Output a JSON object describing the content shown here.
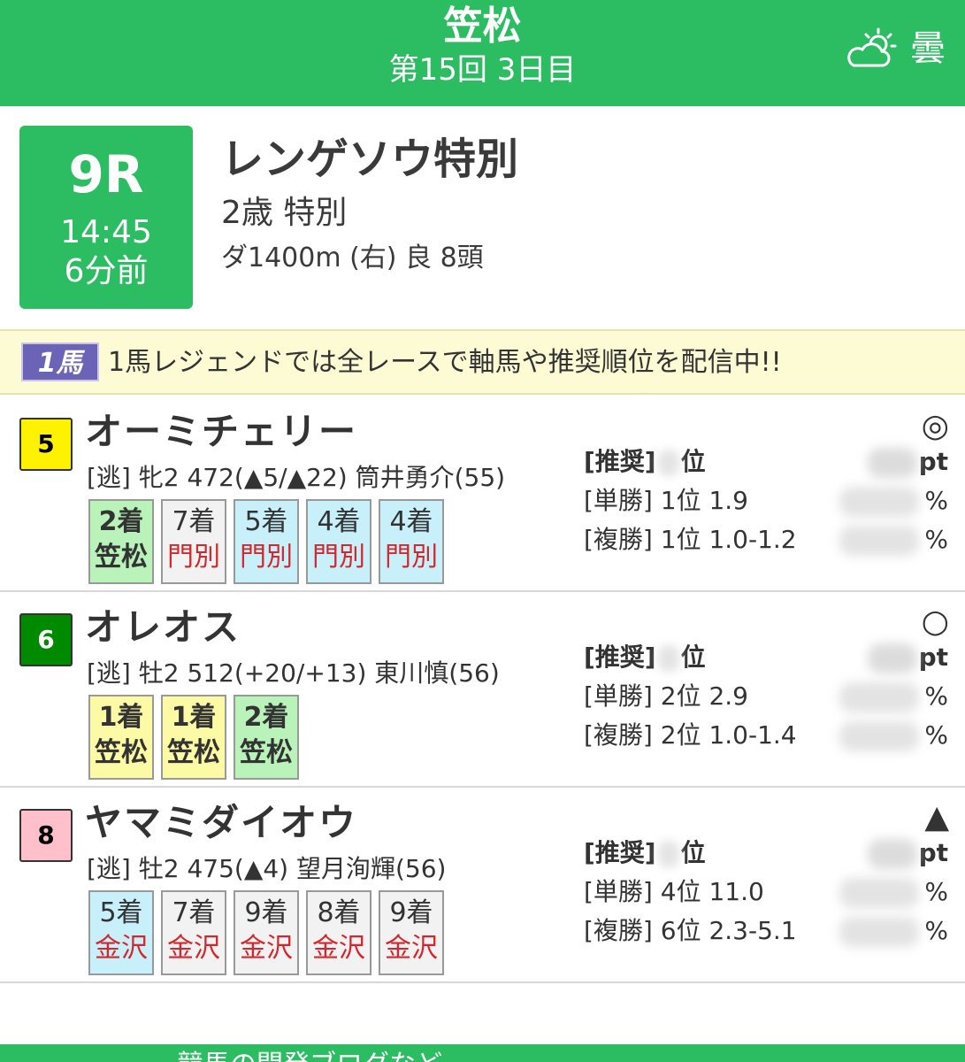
{
  "header": {
    "title": "笠松",
    "subtitle": "第15回 3日目",
    "weather_icon": "cloudy-sun-icon",
    "weather_label": "曇"
  },
  "race": {
    "number": "9R",
    "time": "14:45",
    "countdown": "6分前",
    "name": "レンゲソウ特別",
    "class": "2歳 特別",
    "course": "ダ1400m (右) 良 8頭"
  },
  "banner": {
    "logo": "1馬",
    "text": "1馬レジェンドでは全レースで軸馬や推奨順位を配信中!!"
  },
  "entries": [
    {
      "number": "5",
      "badge_color": "#fff200",
      "badge_text_color": "#000000",
      "name": "オーミチェリー",
      "detail": "[逃] 牝2 472(▲5/▲22) 筒井勇介(55)",
      "mark": "◎",
      "results": [
        {
          "pos": "2着",
          "venue": "笠松",
          "bg": "green",
          "venue_color": "dark",
          "bold": true
        },
        {
          "pos": "7着",
          "venue": "門別",
          "bg": "gray",
          "venue_color": "red",
          "bold": false
        },
        {
          "pos": "5着",
          "venue": "門別",
          "bg": "blue",
          "venue_color": "red",
          "bold": false
        },
        {
          "pos": "4着",
          "venue": "門別",
          "bg": "blue",
          "venue_color": "red",
          "bold": false
        },
        {
          "pos": "4着",
          "venue": "門別",
          "bg": "blue",
          "venue_color": "red",
          "bold": false
        }
      ],
      "recommend_label": "[推奨]",
      "recommend_unit": "位",
      "points_unit": "pt",
      "win": "[単勝] 1位 1.9",
      "place": "[複勝] 1位 1.0-1.2",
      "percent": "%"
    },
    {
      "number": "6",
      "badge_color": "#008a00",
      "badge_text_color": "#ffffff",
      "name": "オレオス",
      "detail": "[逃] 牡2 512(+20/+13) 東川慎(56)",
      "mark": "○",
      "results": [
        {
          "pos": "1着",
          "venue": "笠松",
          "bg": "yellow",
          "venue_color": "dark",
          "bold": true
        },
        {
          "pos": "1着",
          "venue": "笠松",
          "bg": "yellow",
          "venue_color": "dark",
          "bold": true
        },
        {
          "pos": "2着",
          "venue": "笠松",
          "bg": "green",
          "venue_color": "dark",
          "bold": true
        }
      ],
      "recommend_label": "[推奨]",
      "recommend_unit": "位",
      "points_unit": "pt",
      "win": "[単勝] 2位 2.9",
      "place": "[複勝] 2位 1.0-1.4",
      "percent": "%"
    },
    {
      "number": "8",
      "badge_color": "#ffc0cb",
      "badge_text_color": "#000000",
      "name": "ヤマミダイオウ",
      "detail": "[逃] 牡2 475(▲4) 望月洵輝(56)",
      "mark": "▲",
      "results": [
        {
          "pos": "5着",
          "venue": "金沢",
          "bg": "blue",
          "venue_color": "red",
          "bold": false
        },
        {
          "pos": "7着",
          "venue": "金沢",
          "bg": "gray",
          "venue_color": "red",
          "bold": false
        },
        {
          "pos": "9着",
          "venue": "金沢",
          "bg": "gray",
          "venue_color": "red",
          "bold": false
        },
        {
          "pos": "8着",
          "venue": "金沢",
          "bg": "gray",
          "venue_color": "red",
          "bold": false
        },
        {
          "pos": "9着",
          "venue": "金沢",
          "bg": "gray",
          "venue_color": "red",
          "bold": false
        }
      ],
      "recommend_label": "[推奨]",
      "recommend_unit": "位",
      "points_unit": "pt",
      "win": "[単勝] 4位 11.0",
      "place": "[複勝] 6位 2.3-5.1",
      "percent": "%"
    }
  ],
  "footer": {
    "text": "競馬の開発ブログなど"
  },
  "colors": {
    "accent": "#2cbd62",
    "banner_bg": "#fdfbd3"
  }
}
